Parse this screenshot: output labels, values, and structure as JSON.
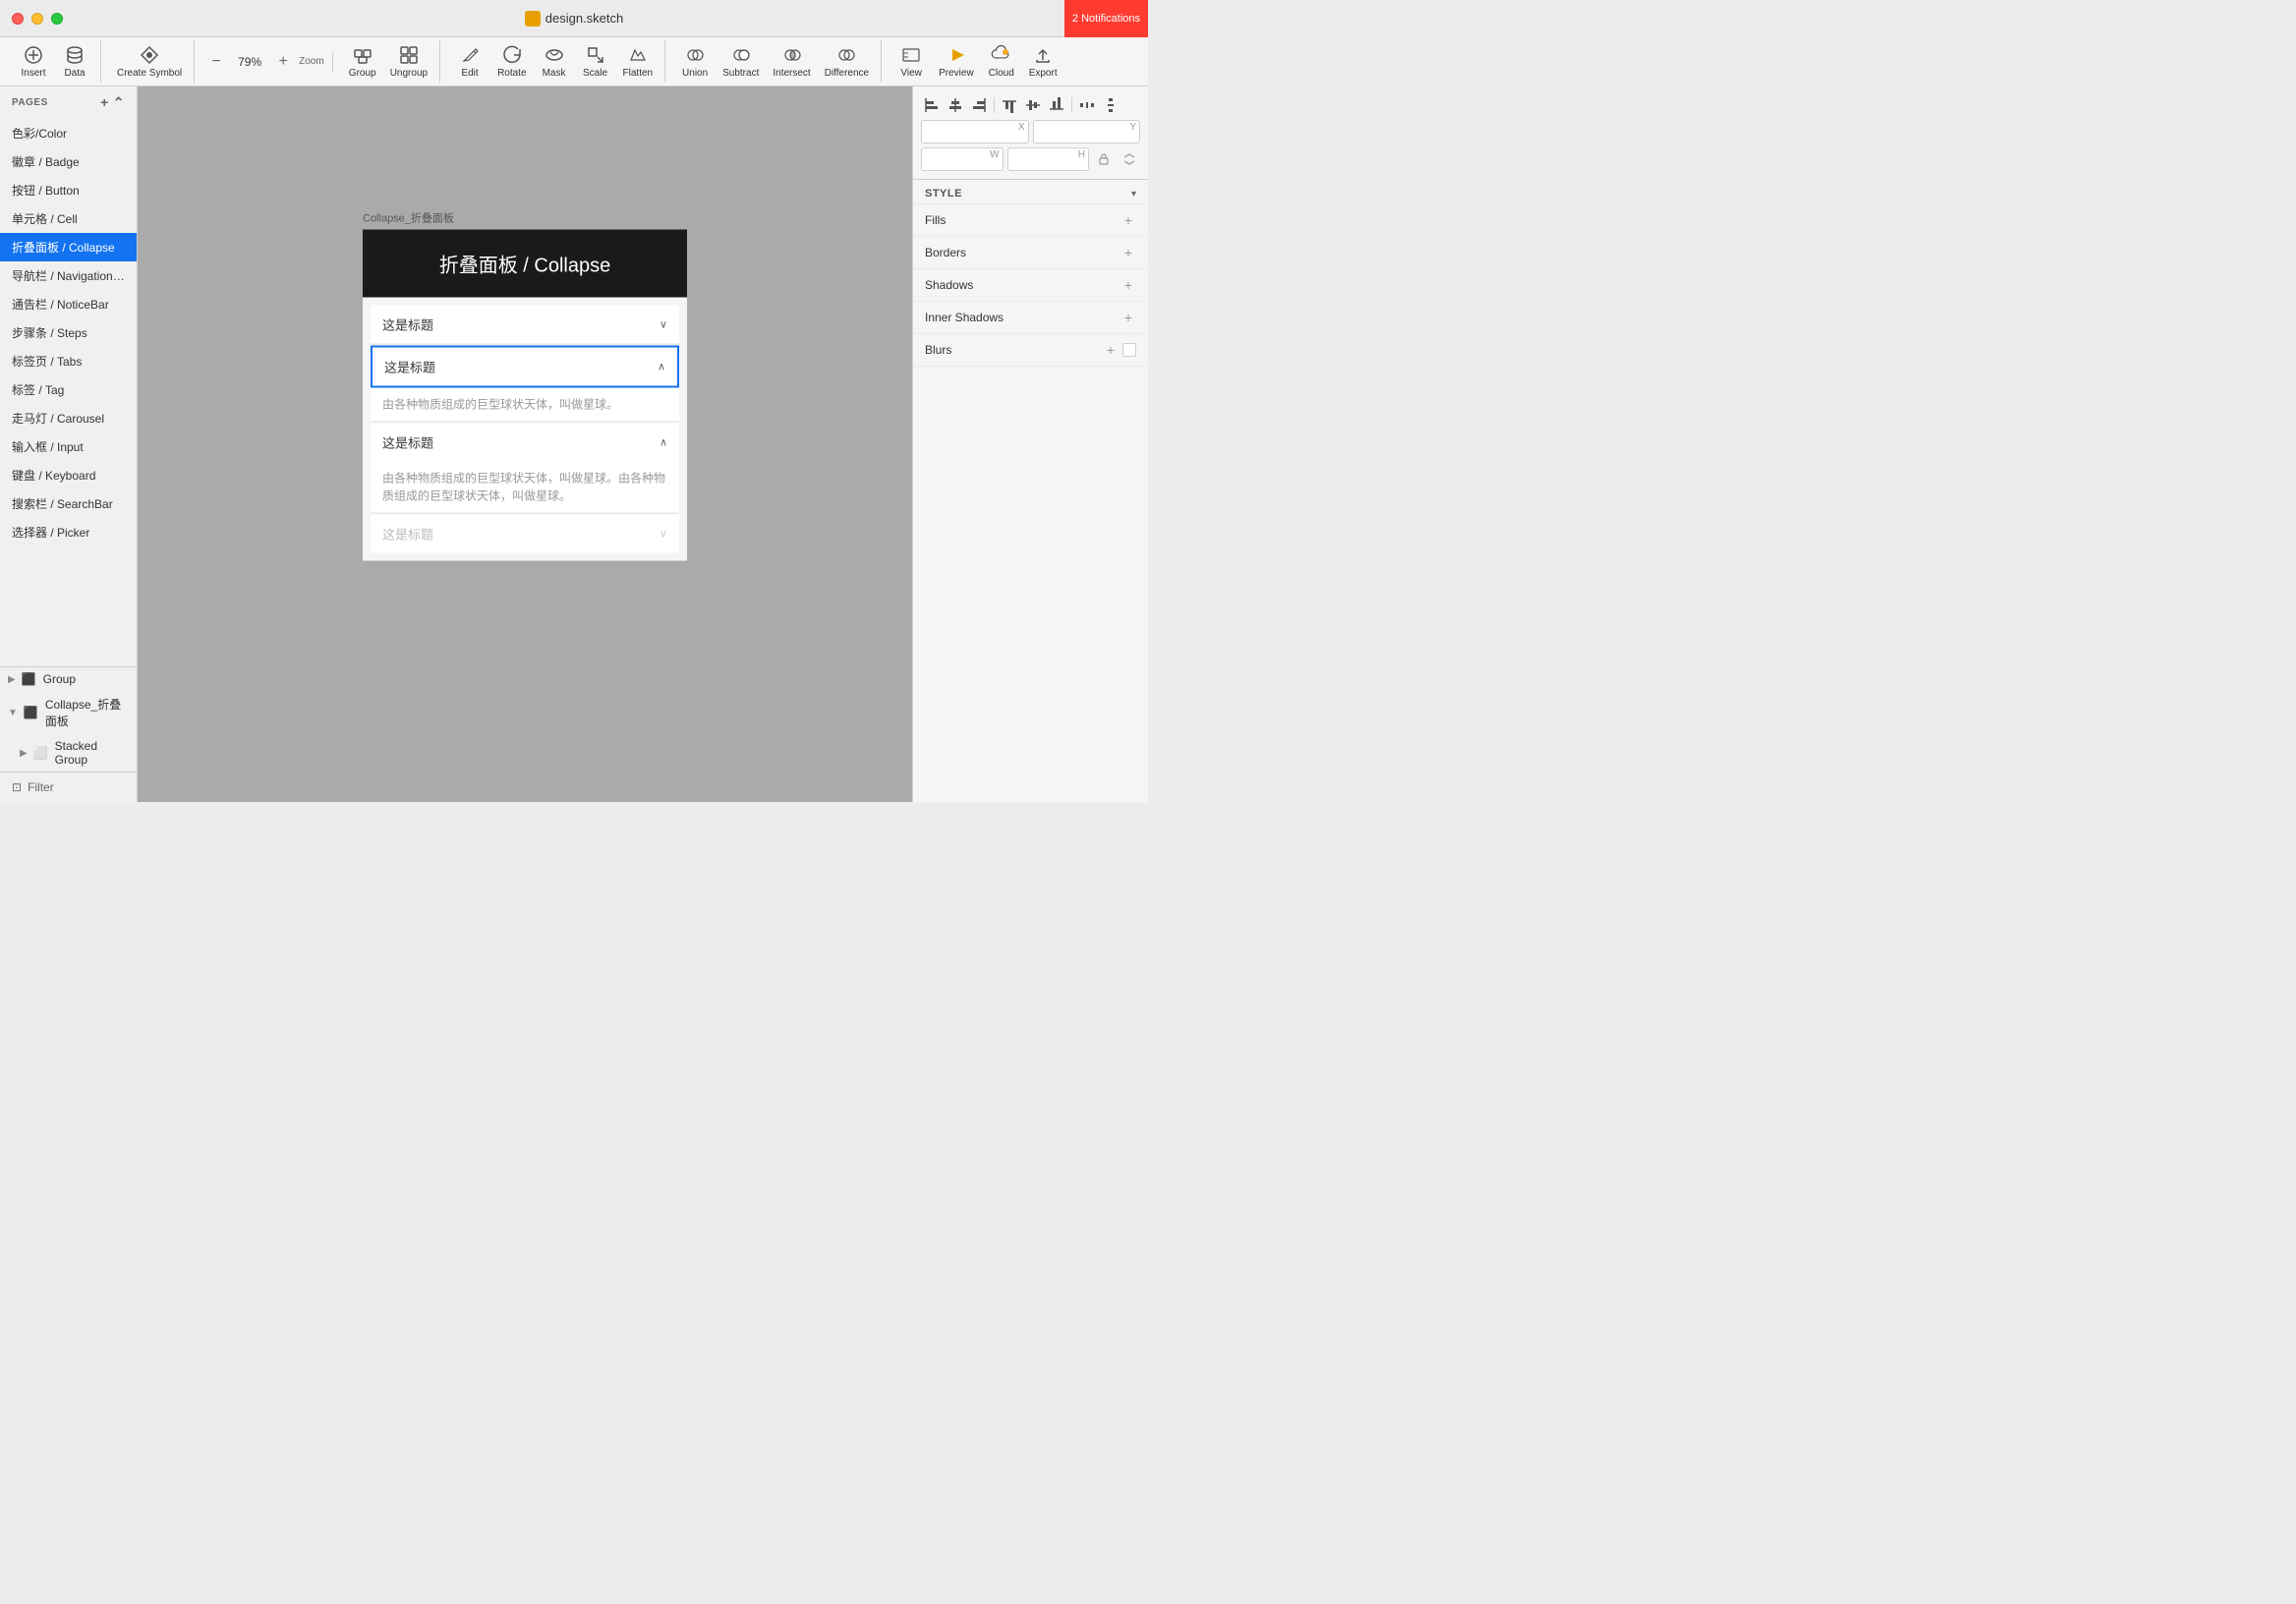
{
  "titlebar": {
    "title": "design.sketch",
    "notifications": "2 Notifications"
  },
  "toolbar": {
    "insert_label": "Insert",
    "data_label": "Data",
    "create_symbol_label": "Create Symbol",
    "zoom_label": "Zoom",
    "zoom_value": "79%",
    "group_label": "Group",
    "ungroup_label": "Ungroup",
    "edit_label": "Edit",
    "rotate_label": "Rotate",
    "mask_label": "Mask",
    "scale_label": "Scale",
    "flatten_label": "Flatten",
    "union_label": "Union",
    "subtract_label": "Subtract",
    "intersect_label": "Intersect",
    "difference_label": "Difference",
    "view_label": "View",
    "preview_label": "Preview",
    "cloud_label": "Cloud",
    "export_label": "Export"
  },
  "pages": {
    "header": "PAGES",
    "add_btn": "+",
    "collapse_btn": "^",
    "items": [
      {
        "label": "色彩/Color"
      },
      {
        "label": "徽章 / Badge"
      },
      {
        "label": "按钮 / Button"
      },
      {
        "label": "单元格 / Cell"
      },
      {
        "label": "折叠面板 / Collapse",
        "active": true
      },
      {
        "label": "导航栏 / NavigationBar"
      },
      {
        "label": "通告栏 / NoticeBar"
      },
      {
        "label": "步骤条 / Steps"
      },
      {
        "label": "标签页 / Tabs"
      },
      {
        "label": "标签 / Tag"
      },
      {
        "label": "走马灯 / Carousel"
      },
      {
        "label": "输入框 / Input"
      },
      {
        "label": "键盘 / Keyboard"
      },
      {
        "label": "搜索栏 / SearchBar"
      },
      {
        "label": "选择器 / Picker"
      }
    ]
  },
  "layers": {
    "items": [
      {
        "label": "Group",
        "type": "group",
        "expanded": false
      },
      {
        "label": "Collapse_折叠面板",
        "type": "group",
        "expanded": true
      },
      {
        "label": "Stacked Group",
        "type": "stacked",
        "expanded": false
      }
    ]
  },
  "filter": {
    "label": "Filter"
  },
  "artboard": {
    "label": "Collapse_折叠面板",
    "title": "折叠面板 / Collapse",
    "collapse_items": [
      {
        "title": "这是标题",
        "expanded": false,
        "active": false,
        "body": ""
      },
      {
        "title": "这是标题",
        "expanded": false,
        "active": true,
        "body": "由各种物质组成的巨型球状天体，叫做星球。"
      },
      {
        "title": "这是标题",
        "expanded": true,
        "active": false,
        "body": "由各种物质组成的巨型球状天体，叫做星球。由各种物质组成的巨型球状天体，叫做星球。"
      },
      {
        "title": "这是标题",
        "expanded": false,
        "active": false,
        "disabled": true,
        "body": ""
      }
    ]
  },
  "right_panel": {
    "style_label": "STYLE",
    "fills_label": "Fills",
    "borders_label": "Borders",
    "shadows_label": "Shadows",
    "inner_shadows_label": "Inner Shadows",
    "blurs_label": "Blurs"
  }
}
